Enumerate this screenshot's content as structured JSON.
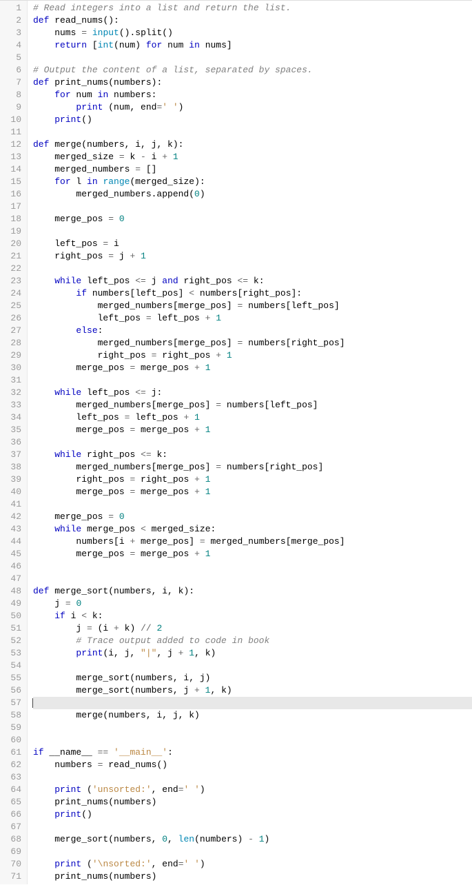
{
  "current_line": 57,
  "lines": [
    {
      "n": 1,
      "html": "<span class='cm'># Read integers into a list and return the list.</span>"
    },
    {
      "n": 2,
      "html": "<span class='kw'>def</span> <span class='nm'>read_nums</span>():"
    },
    {
      "n": 3,
      "html": "    nums <span class='op'>=</span> <span class='nb'>input</span>().split()"
    },
    {
      "n": 4,
      "html": "    <span class='kw'>return</span> [<span class='nb'>int</span>(num) <span class='kw'>for</span> num <span class='kw'>in</span> nums]"
    },
    {
      "n": 5,
      "html": ""
    },
    {
      "n": 6,
      "html": "<span class='cm'># Output the content of a list, separated by spaces.</span>"
    },
    {
      "n": 7,
      "html": "<span class='kw'>def</span> <span class='nm'>print_nums</span>(numbers):"
    },
    {
      "n": 8,
      "html": "    <span class='kw'>for</span> num <span class='kw'>in</span> numbers:"
    },
    {
      "n": 9,
      "html": "        <span class='kw'>print</span> (num, end<span class='op'>=</span><span class='st'>' '</span>)"
    },
    {
      "n": 10,
      "html": "    <span class='kw'>print</span>()"
    },
    {
      "n": 11,
      "html": ""
    },
    {
      "n": 12,
      "html": "<span class='kw'>def</span> <span class='nm'>merge</span>(numbers, i, j, k):"
    },
    {
      "n": 13,
      "html": "    merged_size <span class='op'>=</span> k <span class='op'>-</span> i <span class='op'>+</span> <span class='num'>1</span>"
    },
    {
      "n": 14,
      "html": "    merged_numbers <span class='op'>=</span> []"
    },
    {
      "n": 15,
      "html": "    <span class='kw'>for</span> l <span class='kw'>in</span> <span class='nb'>range</span>(merged_size):"
    },
    {
      "n": 16,
      "html": "        merged_numbers.append(<span class='num'>0</span>)"
    },
    {
      "n": 17,
      "html": ""
    },
    {
      "n": 18,
      "html": "    merge_pos <span class='op'>=</span> <span class='num'>0</span>"
    },
    {
      "n": 19,
      "html": ""
    },
    {
      "n": 20,
      "html": "    left_pos <span class='op'>=</span> i"
    },
    {
      "n": 21,
      "html": "    right_pos <span class='op'>=</span> j <span class='op'>+</span> <span class='num'>1</span>"
    },
    {
      "n": 22,
      "html": ""
    },
    {
      "n": 23,
      "html": "    <span class='kw'>while</span> left_pos <span class='op'>&lt;=</span> j <span class='kw'>and</span> right_pos <span class='op'>&lt;=</span> k:"
    },
    {
      "n": 24,
      "html": "        <span class='kw'>if</span> numbers[left_pos] <span class='op'>&lt;</span> numbers[right_pos]:"
    },
    {
      "n": 25,
      "html": "            merged_numbers[merge_pos] <span class='op'>=</span> numbers[left_pos]"
    },
    {
      "n": 26,
      "html": "            left_pos <span class='op'>=</span> left_pos <span class='op'>+</span> <span class='num'>1</span>"
    },
    {
      "n": 27,
      "html": "        <span class='kw'>else</span>:"
    },
    {
      "n": 28,
      "html": "            merged_numbers[merge_pos] <span class='op'>=</span> numbers[right_pos]"
    },
    {
      "n": 29,
      "html": "            right_pos <span class='op'>=</span> right_pos <span class='op'>+</span> <span class='num'>1</span>"
    },
    {
      "n": 30,
      "html": "        merge_pos <span class='op'>=</span> merge_pos <span class='op'>+</span> <span class='num'>1</span>"
    },
    {
      "n": 31,
      "html": ""
    },
    {
      "n": 32,
      "html": "    <span class='kw'>while</span> left_pos <span class='op'>&lt;=</span> j:"
    },
    {
      "n": 33,
      "html": "        merged_numbers[merge_pos] <span class='op'>=</span> numbers[left_pos]"
    },
    {
      "n": 34,
      "html": "        left_pos <span class='op'>=</span> left_pos <span class='op'>+</span> <span class='num'>1</span>"
    },
    {
      "n": 35,
      "html": "        merge_pos <span class='op'>=</span> merge_pos <span class='op'>+</span> <span class='num'>1</span>"
    },
    {
      "n": 36,
      "html": ""
    },
    {
      "n": 37,
      "html": "    <span class='kw'>while</span> right_pos <span class='op'>&lt;=</span> k:"
    },
    {
      "n": 38,
      "html": "        merged_numbers[merge_pos] <span class='op'>=</span> numbers[right_pos]"
    },
    {
      "n": 39,
      "html": "        right_pos <span class='op'>=</span> right_pos <span class='op'>+</span> <span class='num'>1</span>"
    },
    {
      "n": 40,
      "html": "        merge_pos <span class='op'>=</span> merge_pos <span class='op'>+</span> <span class='num'>1</span>"
    },
    {
      "n": 41,
      "html": ""
    },
    {
      "n": 42,
      "html": "    merge_pos <span class='op'>=</span> <span class='num'>0</span>"
    },
    {
      "n": 43,
      "html": "    <span class='kw'>while</span> merge_pos <span class='op'>&lt;</span> merged_size:"
    },
    {
      "n": 44,
      "html": "        numbers[i <span class='op'>+</span> merge_pos] <span class='op'>=</span> merged_numbers[merge_pos]"
    },
    {
      "n": 45,
      "html": "        merge_pos <span class='op'>=</span> merge_pos <span class='op'>+</span> <span class='num'>1</span>"
    },
    {
      "n": 46,
      "html": ""
    },
    {
      "n": 47,
      "html": ""
    },
    {
      "n": 48,
      "html": "<span class='kw'>def</span> <span class='nm'>merge_sort</span>(numbers, i, k):"
    },
    {
      "n": 49,
      "html": "    j <span class='op'>=</span> <span class='num'>0</span>"
    },
    {
      "n": 50,
      "html": "    <span class='kw'>if</span> i <span class='op'>&lt;</span> k:"
    },
    {
      "n": 51,
      "html": "        j <span class='op'>=</span> (i <span class='op'>+</span> k) <span class='op'>//</span> <span class='num'>2</span>"
    },
    {
      "n": 52,
      "html": "        <span class='cm'># Trace output added to code in book</span>"
    },
    {
      "n": 53,
      "html": "        <span class='kw'>print</span>(i, j, <span class='st'>\"|\"</span>, j <span class='op'>+</span> <span class='num'>1</span>, k)"
    },
    {
      "n": 54,
      "html": ""
    },
    {
      "n": 55,
      "html": "        merge_sort(numbers, i, j)"
    },
    {
      "n": 56,
      "html": "        merge_sort(numbers, j <span class='op'>+</span> <span class='num'>1</span>, k)"
    },
    {
      "n": 57,
      "html": ""
    },
    {
      "n": 58,
      "html": "        merge(numbers, i, j, k)"
    },
    {
      "n": 59,
      "html": ""
    },
    {
      "n": 60,
      "html": ""
    },
    {
      "n": 61,
      "html": "<span class='kw'>if</span> __name__ <span class='op'>==</span> <span class='st'>'__main__'</span>:"
    },
    {
      "n": 62,
      "html": "    numbers <span class='op'>=</span> read_nums()"
    },
    {
      "n": 63,
      "html": ""
    },
    {
      "n": 64,
      "html": "    <span class='kw'>print</span> (<span class='st'>'unsorted:'</span>, end<span class='op'>=</span><span class='st'>' '</span>)"
    },
    {
      "n": 65,
      "html": "    print_nums(numbers)"
    },
    {
      "n": 66,
      "html": "    <span class='kw'>print</span>()"
    },
    {
      "n": 67,
      "html": ""
    },
    {
      "n": 68,
      "html": "    merge_sort(numbers, <span class='num'>0</span>, <span class='nb'>len</span>(numbers) <span class='op'>-</span> <span class='num'>1</span>)"
    },
    {
      "n": 69,
      "html": ""
    },
    {
      "n": 70,
      "html": "    <span class='kw'>print</span> (<span class='st'>'\\nsorted:'</span>, end<span class='op'>=</span><span class='st'>' '</span>)"
    },
    {
      "n": 71,
      "html": "    print_nums(numbers)"
    }
  ]
}
